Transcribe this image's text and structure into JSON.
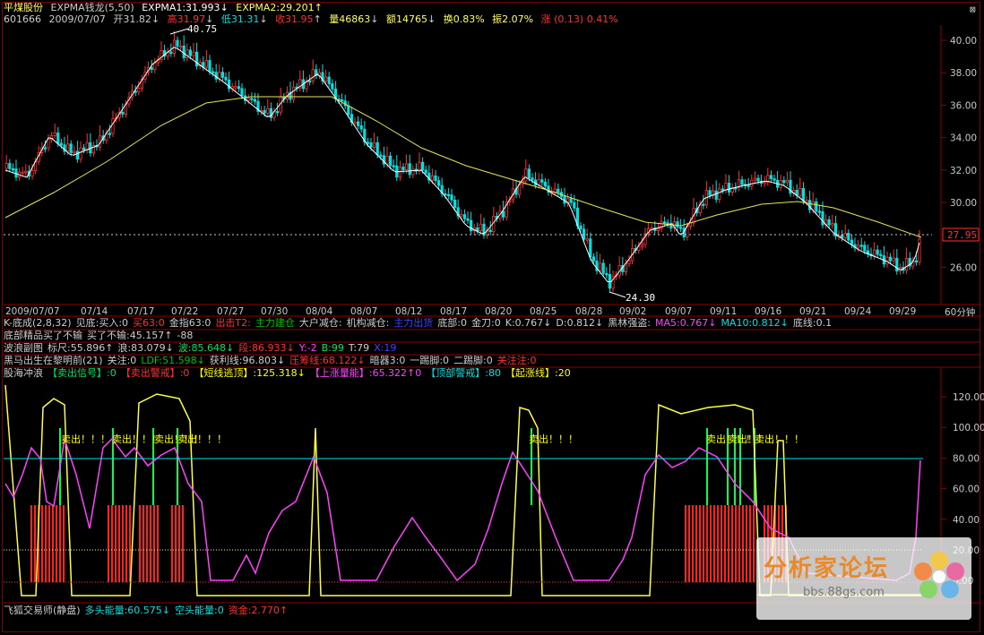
{
  "header": {
    "stock_name": "平煤股份",
    "indicator_name": "EXPMA钱龙",
    "indicator_params": "(5,50)",
    "expma1": "EXPMA1:31.993",
    "expma1_arrow": "↓",
    "expma2": "EXPMA2:29.201",
    "expma2_arrow": "↑",
    "close_mark": "⊠"
  },
  "quote": {
    "code": "601666",
    "date": "2009/07/07",
    "open": "开31.82",
    "open_arrow": "↓",
    "high": "高31.97",
    "high_arrow": "↓",
    "low": "低31.31",
    "low_arrow": "↓",
    "close": "收31.95",
    "close_arrow": "↑",
    "volume": "量46863",
    "volume_arrow": "↓",
    "amount": "额14765",
    "amount_arrow": "↓",
    "turnover": "换0.83%",
    "amplitude": "振2.07%",
    "change": "涨 (0.13) 0.41%"
  },
  "price_axis": [
    "40.00",
    "38.00",
    "36.00",
    "34.00",
    "32.00",
    "30.00",
    "28.00",
    "26.00"
  ],
  "current_price": "27.95",
  "high_label": "40.75",
  "low_label": "24.30",
  "date_axis": [
    "2009/07/07",
    "07/14",
    "07/17",
    "07/22",
    "07/27",
    "07/30",
    "08/04",
    "08/07",
    "08/12",
    "08/17",
    "08/20",
    "08/25",
    "08/28",
    "09/02",
    "09/07",
    "09/11",
    "09/16",
    "09/21",
    "09/24",
    "09/29"
  ],
  "period": "60分钟",
  "indicators": {
    "row1": [
      {
        "text": "K-底成(2,8,32)",
        "color": "#cccccc"
      },
      {
        "text": "见底:买入:0",
        "color": "#cccccc"
      },
      {
        "text": "买63:0",
        "color": "#ff3030"
      },
      {
        "text": "金指63:0",
        "color": "#cccccc"
      },
      {
        "text": "出击T2:",
        "color": "#ff3030"
      },
      {
        "text": "主力建仓",
        "color": "#00c000"
      },
      {
        "text": "大户减仓:",
        "color": "#cccccc"
      },
      {
        "text": "机构减仓:",
        "color": "#cccccc"
      },
      {
        "text": "主力出货",
        "color": "#4040ff"
      },
      {
        "text": "底部:0",
        "color": "#cccccc"
      },
      {
        "text": "金刀:0",
        "color": "#cccccc"
      },
      {
        "text": "K:0.767↓",
        "color": "#cccccc"
      },
      {
        "text": "D:0.812↓",
        "color": "#cccccc"
      },
      {
        "text": "黑林强盗:",
        "color": "#cccccc"
      },
      {
        "text": "MA5:0.767↓",
        "color": "#ff40ff"
      },
      {
        "text": "MA10:0.812↓",
        "color": "#00e0e0"
      },
      {
        "text": "底线:0.1",
        "color": "#cccccc"
      }
    ],
    "row2": [
      {
        "text": "底部精品买了不输",
        "color": "#cccccc"
      },
      {
        "text": "买了不输:45.157↑",
        "color": "#cccccc"
      },
      {
        "text": "-88",
        "color": "#cccccc"
      }
    ],
    "row3": [
      {
        "text": "波浪副图",
        "color": "#cccccc"
      },
      {
        "text": "标尺:55.896↑",
        "color": "#cccccc"
      },
      {
        "text": "浪:83.079↓",
        "color": "#cccccc"
      },
      {
        "text": "波:85.648↓",
        "color": "#00e060"
      },
      {
        "text": "段:86.933↓",
        "color": "#ff3030"
      },
      {
        "text": "Y:-2",
        "color": "#ff40ff"
      },
      {
        "text": "B:99",
        "color": "#00e060"
      },
      {
        "text": "T:79",
        "color": "#cccccc"
      },
      {
        "text": "X:19",
        "color": "#4040ff"
      }
    ],
    "row4": [
      {
        "text": "黑马出生在黎明前(21)",
        "color": "#cccccc"
      },
      {
        "text": "关注:0",
        "color": "#cccccc"
      },
      {
        "text": "LDF:51.598↓",
        "color": "#00c000"
      },
      {
        "text": "获利线:96.803↓",
        "color": "#cccccc"
      },
      {
        "text": "压筹线:68.122↓",
        "color": "#ff3030"
      },
      {
        "text": "暗器3:0",
        "color": "#cccccc"
      },
      {
        "text": "一踢脚:0",
        "color": "#cccccc"
      },
      {
        "text": "二踢脚:0",
        "color": "#cccccc"
      },
      {
        "text": "关注注:0",
        "color": "#ff3030"
      }
    ],
    "row5": [
      {
        "text": "股海冲浪",
        "color": "#cccccc"
      },
      {
        "text": "【卖出信号】:0",
        "color": "#00e060"
      },
      {
        "text": "【卖出警戒】:0",
        "color": "#ff3030"
      },
      {
        "text": "【短线逃顶】:125.318↓",
        "color": "#ffff00"
      },
      {
        "text": "【上涨量能】:65.322↑0",
        "color": "#ff40ff"
      },
      {
        "text": "【顶部警戒】:80",
        "color": "#00e0e0"
      },
      {
        "text": "【起涨线】:20",
        "color": "#ffff00"
      }
    ]
  },
  "osc_axis": [
    "120.00",
    "100.00",
    "80.00",
    "60.00",
    "40.00",
    "20.00",
    "0.00"
  ],
  "sell_marks": [
    "卖出！！！",
    "卖出！！！",
    "卖出！！！",
    "卖出！！！",
    "卖出！！！",
    "卖出！！！",
    "卖出！！！",
    "卖出！！！"
  ],
  "footer": [
    {
      "text": "飞狐交易师(静盘)",
      "color": "#cccccc"
    },
    {
      "text": "多头能量:60.575↓",
      "color": "#00e0e0"
    },
    {
      "text": "空头能量:0",
      "color": "#00e0e0"
    },
    {
      "text": "资金:2.770↑",
      "color": "#ff3030"
    }
  ],
  "watermark": {
    "title": "分析家论坛",
    "url": "bbs.88gs.com"
  },
  "colors": {
    "up": "#ff3030",
    "down": "#00e0e0",
    "expma_fast": "#ffffff",
    "expma_slow": "#e6e65a",
    "axis": "#8b0000",
    "osc_yellow": "#ffff40",
    "osc_magenta": "#ff40ff",
    "osc_green": "#00ff40"
  }
}
